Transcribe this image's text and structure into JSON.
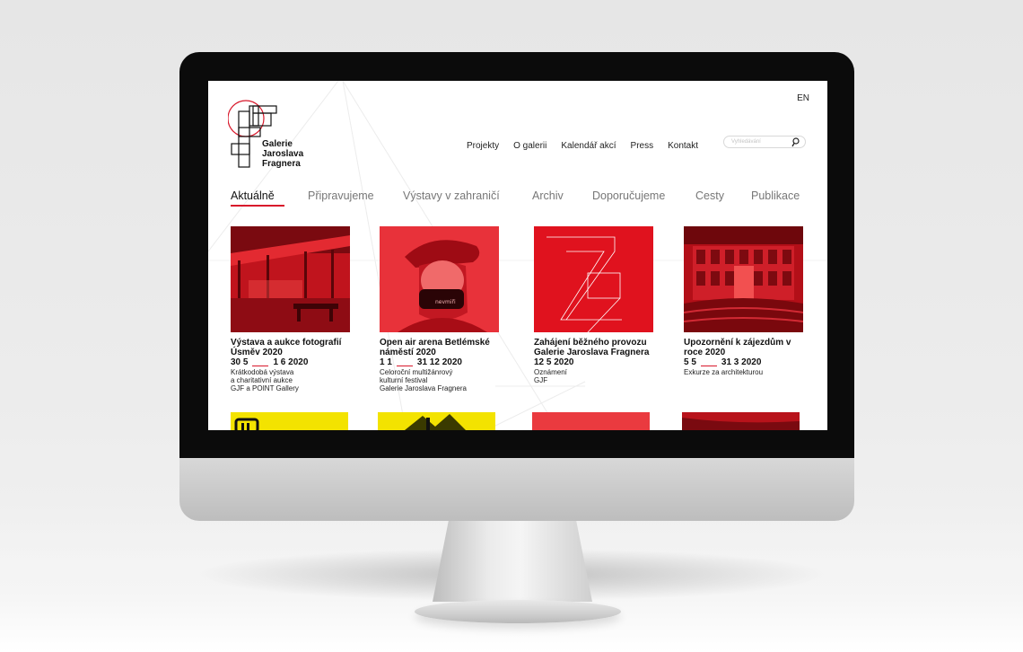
{
  "site": {
    "logo_lines": [
      "Galerie",
      "Jaroslava",
      "Fragnera"
    ],
    "lang_label": "EN",
    "nav": [
      "Projekty",
      "O galerii",
      "Kalendář akcí",
      "Press",
      "Kontakt"
    ],
    "search_placeholder": "Vyhledávání",
    "tabs": [
      "Aktuálně",
      "Připravujeme",
      "Výstavy v zahraničí",
      "Archiv",
      "Doporučujeme",
      "Cesty",
      "Publikace"
    ],
    "accent_color": "#d8182b"
  },
  "cards": [
    {
      "title": "Výstava a aukce fotografií Úsměv 2020",
      "date_from": "30  5",
      "date_to": "1  6  2020",
      "meta": [
        "Krátkodobá výstava",
        "a charitativní aukce",
        "GJF a POINT Gallery"
      ]
    },
    {
      "title": "Open air arena Betlémské náměstí 2020",
      "date_from": "1  1",
      "date_to": "31  12  2020",
      "meta": [
        "Celoroční multižánrový",
        "kulturní festival",
        "Galerie Jaroslava Fragnera"
      ],
      "mask_text": "nevmiři"
    },
    {
      "title": "Zahájení běžného provozu Galerie Jaroslava Fragnera",
      "date_from": "12  5  2020",
      "date_to": "",
      "meta": [
        "Oznámení",
        "GJF"
      ]
    },
    {
      "title": "Upozornění k zájezdům v roce 2020",
      "date_from": "5  5",
      "date_to": "31  3  2020",
      "meta": [
        "Exkurze za architekturou"
      ]
    }
  ]
}
